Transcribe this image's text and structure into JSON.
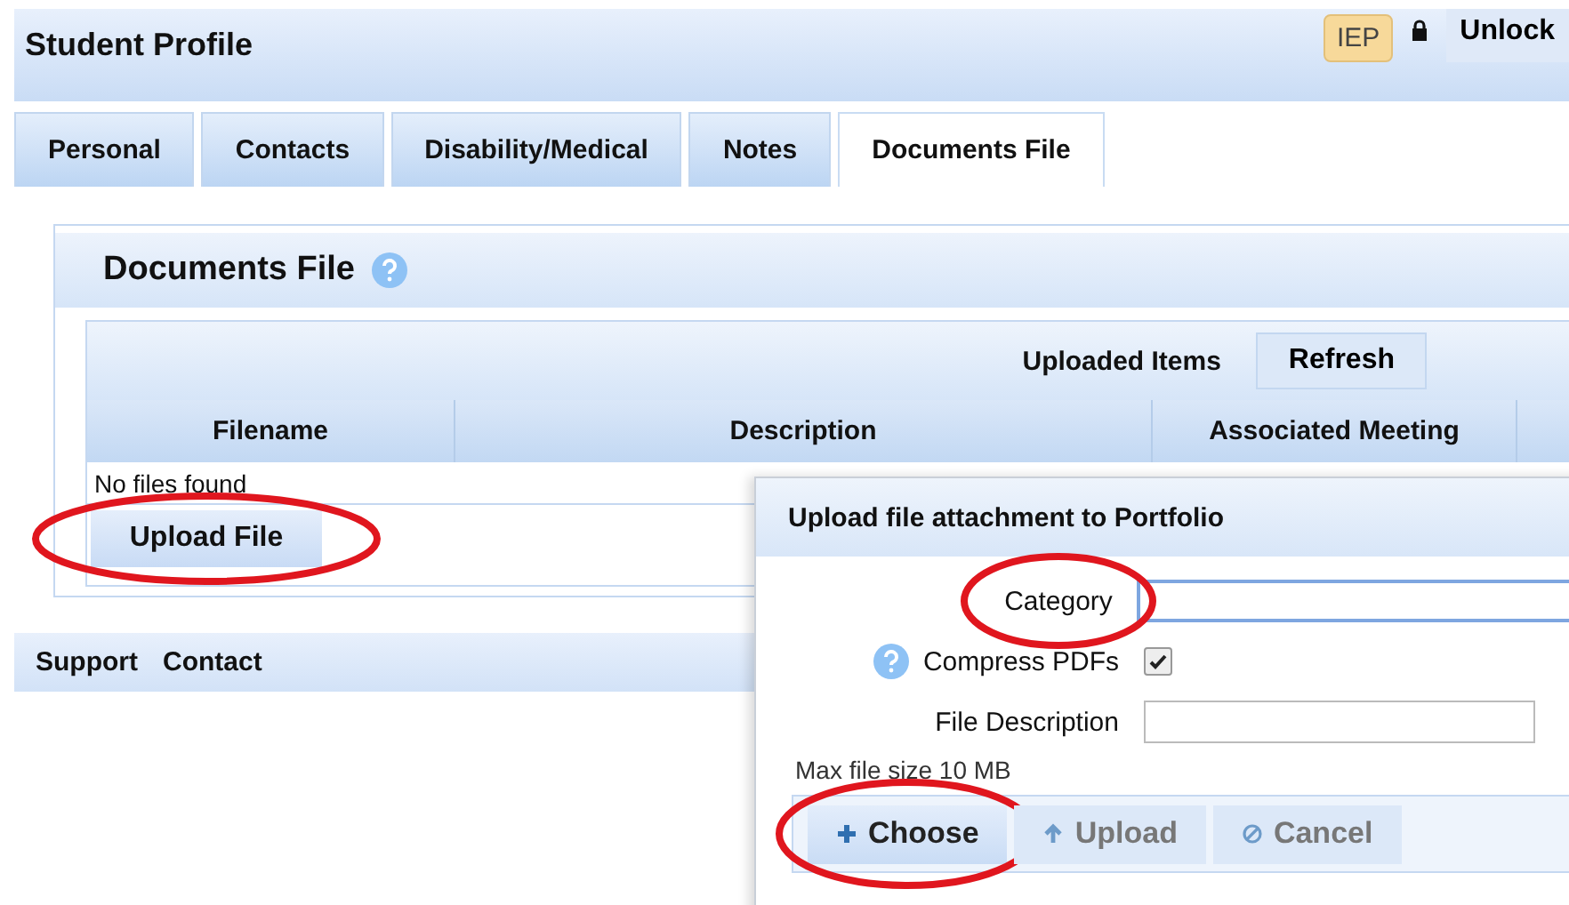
{
  "header": {
    "title": "Student Profile",
    "badge": "IEP",
    "unlock_button": "Unlock"
  },
  "tabs": [
    {
      "label": "Personal",
      "selected": false
    },
    {
      "label": "Contacts",
      "selected": false
    },
    {
      "label": "Disability/Medical",
      "selected": false
    },
    {
      "label": "Notes",
      "selected": false
    },
    {
      "label": "Documents File",
      "selected": true
    }
  ],
  "panel": {
    "title": "Documents File",
    "toolbar_label": "Uploaded Items",
    "refresh_button": "Refresh",
    "table": {
      "columns": [
        "Filename",
        "Description",
        "Associated Meeting"
      ],
      "empty_message": "No files found"
    },
    "upload_button": {
      "label": "Upload File",
      "circled": true
    }
  },
  "footer": {
    "links": [
      "Support",
      "Contact"
    ]
  },
  "dialog": {
    "title": "Upload file attachment to Portfolio",
    "fields": [
      {
        "kind": "input",
        "label": "Category",
        "focused": true,
        "circled": true,
        "help": false
      },
      {
        "kind": "checkbox",
        "label": "Compress PDFs",
        "checked": true,
        "circled": false,
        "help": true
      },
      {
        "kind": "input",
        "label": "File Description",
        "focused": false,
        "circled": false,
        "help": false
      }
    ],
    "note": "Max file size 10 MB",
    "buttons": [
      {
        "kind": "choose",
        "label": "Choose",
        "disabled": false,
        "circled": true
      },
      {
        "kind": "upload",
        "label": "Upload",
        "disabled": true,
        "circled": false
      },
      {
        "kind": "cancel",
        "label": "Cancel",
        "disabled": true,
        "circled": false
      }
    ]
  }
}
